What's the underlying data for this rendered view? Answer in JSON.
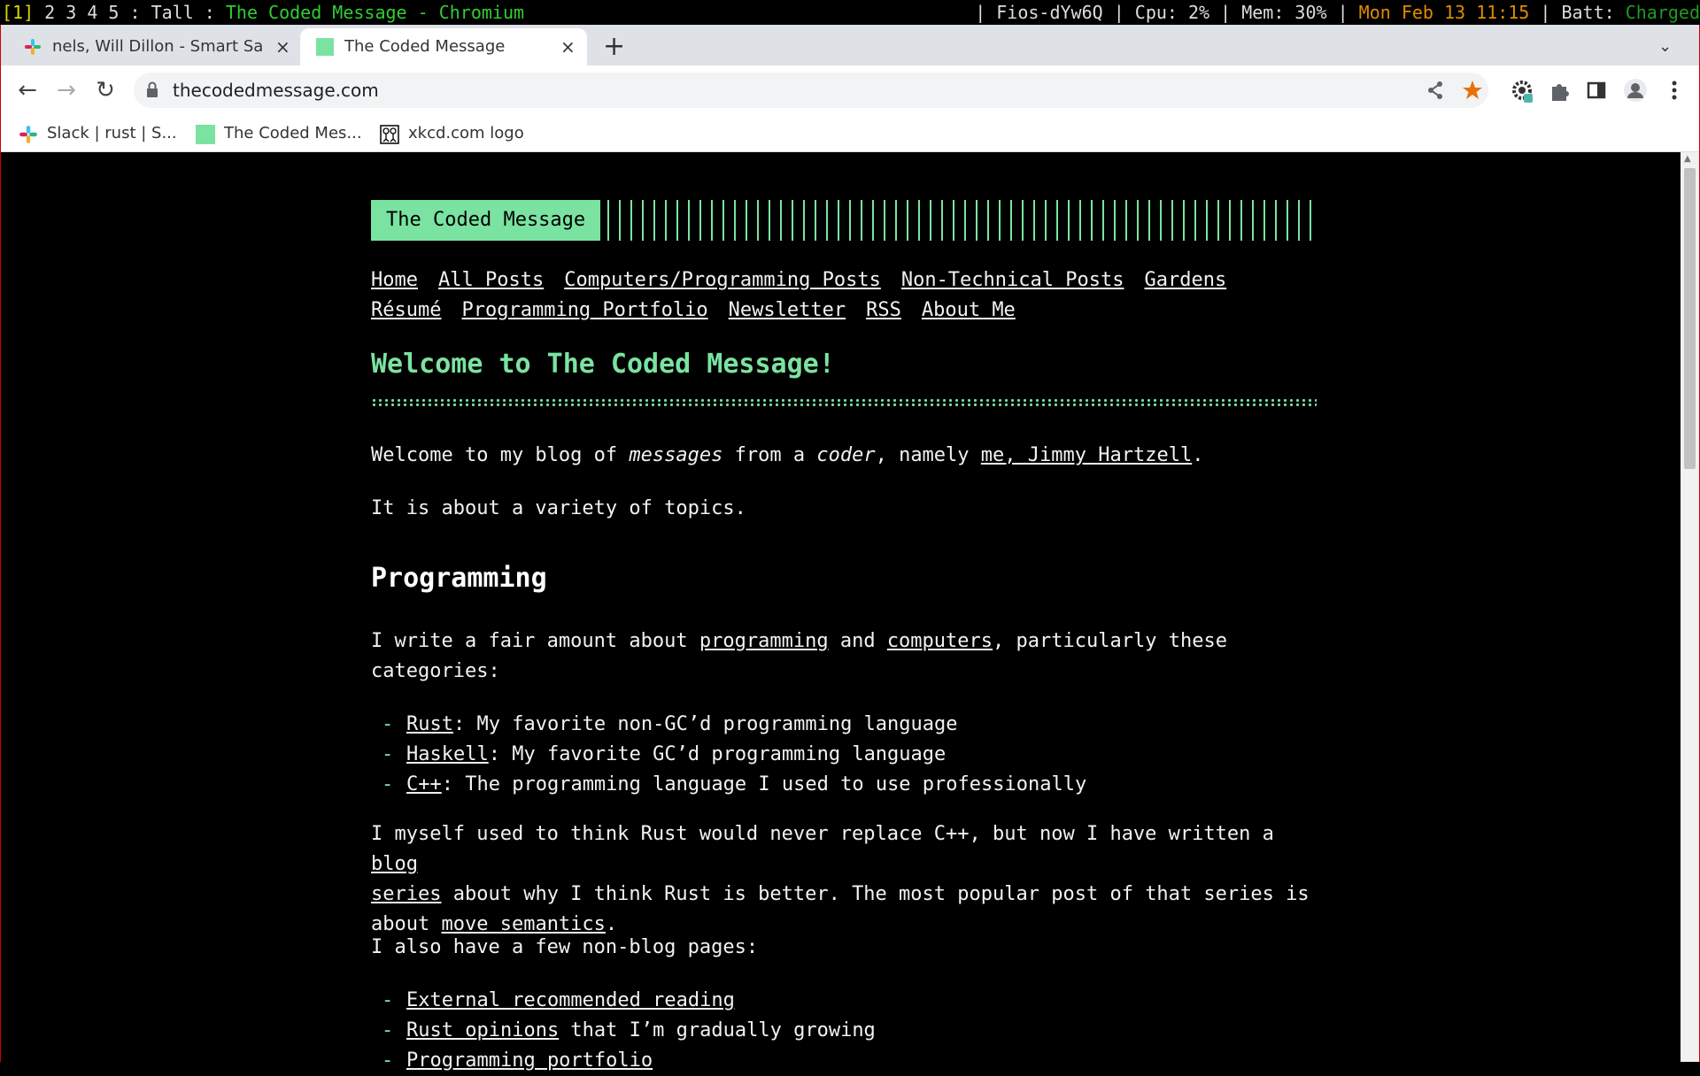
{
  "wm": {
    "workspace_active": "[1]",
    "workspaces_rest": " 2 3 4 5 : Tall : ",
    "window_title": "The Coded Message - Chromium",
    "network": "| Fios-dYw6Q | Cpu: 2% | Mem: 30% | ",
    "datetime": "Mon Feb 13 11:15",
    "batt_label": " | Batt: ",
    "batt_status": "Charged"
  },
  "tabs": [
    {
      "title": "nels, Will Dillon - Smart Sa",
      "close": "×"
    },
    {
      "title": "The Coded Message",
      "close": "×"
    }
  ],
  "new_tab": "+",
  "tab_menu": "⌄",
  "toolbar": {
    "back": "←",
    "forward": "→",
    "reload": "↻",
    "url": "thecodedmessage.com"
  },
  "bookmarks": [
    {
      "label": "Slack | rust | S..."
    },
    {
      "label": "The Coded Mes..."
    },
    {
      "label": "xkcd.com logo"
    }
  ],
  "site": {
    "brand": "The Coded Message",
    "nav_row1": [
      "Home",
      "All Posts",
      "Computers/Programming Posts",
      "Non-Technical Posts",
      "Gardens"
    ],
    "nav_row2": [
      "Résumé",
      "Programming Portfolio",
      "Newsletter",
      "RSS",
      "About Me"
    ],
    "welcome_title": "Welcome to The Coded Message!",
    "intro": {
      "t1": "Welcome to my blog of ",
      "em1": "messages",
      "t2": " from a ",
      "em2": "coder",
      "t3": ", namely ",
      "link": "me, Jimmy Hartzell",
      "t4": "."
    },
    "topics": "It is about a variety of topics.",
    "programming_heading": "Programming",
    "prog_para": {
      "t1": "I write a fair amount about ",
      "link1": "programming",
      "t2": " and ",
      "link2": "computers",
      "t3": ", particularly these",
      "t4": "categories:"
    },
    "categories": [
      {
        "link": "Rust",
        "text": ": My favorite non-GC’d programming language"
      },
      {
        "link": "Haskell",
        "text": ": My favorite GC’d programming language"
      },
      {
        "link": "C++",
        "text": ": The programming language I used to use professionally"
      }
    ],
    "rust_para": {
      "t1": "I myself used to think Rust would never replace C++, but now I have written a ",
      "link1a": "blog",
      "link1b": "series",
      "t2": " about why I think Rust is better. The most popular post of that series is",
      "t3": "about ",
      "link2": "move semantics",
      "t4": "."
    },
    "nonblog_intro": "I also have a few non-blog pages:",
    "pages": [
      {
        "link": "External recommended reading",
        "text": ""
      },
      {
        "link": "Rust opinions",
        "text": " that I’m gradually growing"
      },
      {
        "link": "Programming portfolio",
        "text": ""
      }
    ],
    "dash": "-"
  }
}
